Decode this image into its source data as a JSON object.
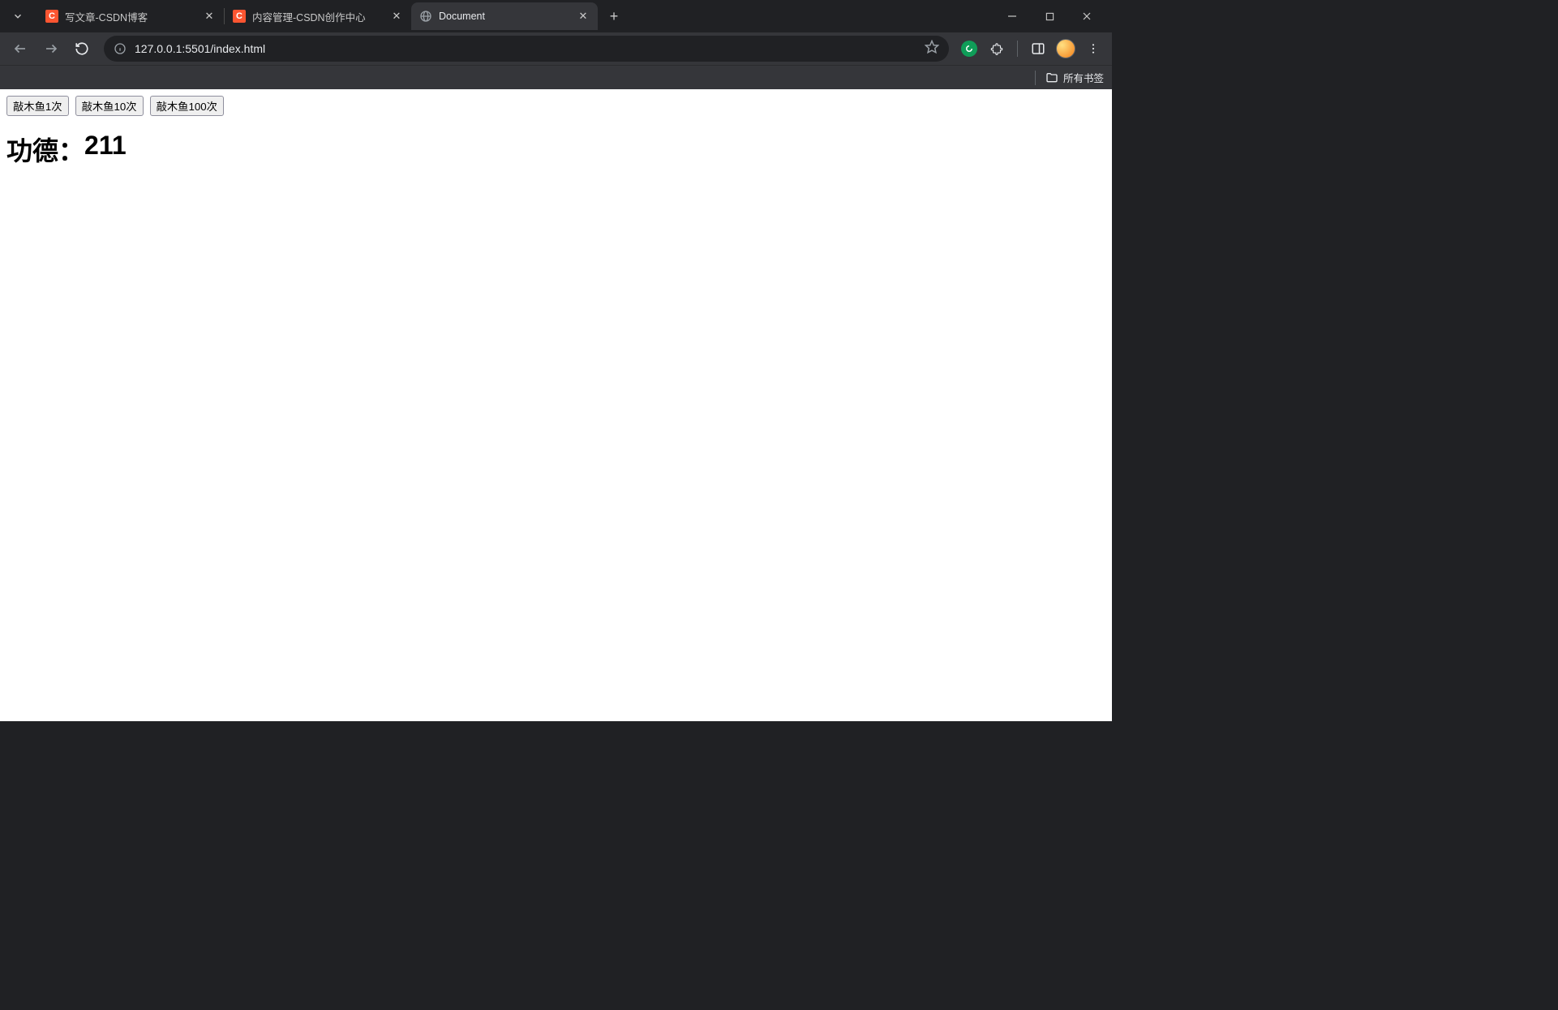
{
  "tabs": [
    {
      "title": "写文章-CSDN博客",
      "favicon": "csdn",
      "active": false
    },
    {
      "title": "内容管理-CSDN创作中心",
      "favicon": "csdn",
      "active": false
    },
    {
      "title": "Document",
      "favicon": "globe",
      "active": true
    }
  ],
  "window_controls": {
    "minimize": "—",
    "maximize": "▢",
    "close": "✕"
  },
  "toolbar": {
    "url": "127.0.0.1:5501/index.html"
  },
  "bookmarks": {
    "all_label": "所有书签"
  },
  "page": {
    "buttons": {
      "knock1": "敲木鱼1次",
      "knock10": "敲木鱼10次",
      "knock100": "敲木鱼100次"
    },
    "merit_label": "功德：",
    "merit_value": "211"
  }
}
